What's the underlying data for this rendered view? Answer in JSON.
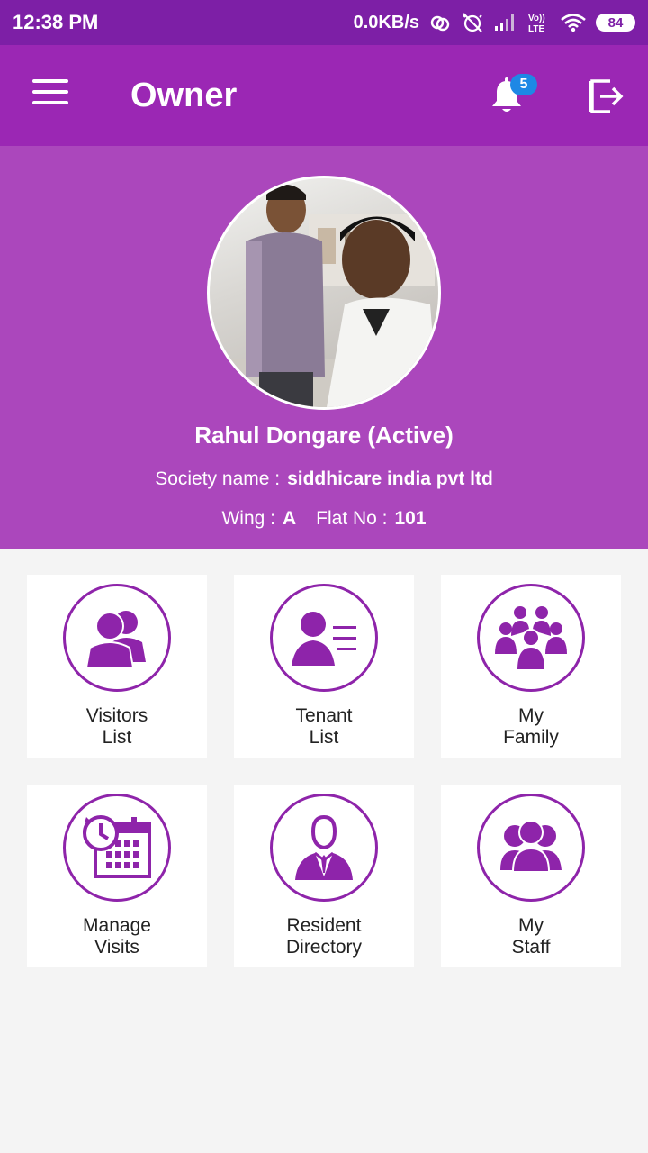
{
  "status_bar": {
    "time": "12:38 PM",
    "network_speed": "0.0KB/s",
    "battery": "84",
    "icons": [
      "hotspot-icon",
      "alarm-off-icon",
      "signal-icon",
      "volte-icon",
      "wifi-icon",
      "battery-icon"
    ]
  },
  "app_bar": {
    "title": "Owner",
    "notification_count": "5",
    "icons": [
      "menu-icon",
      "bell-icon",
      "logout-icon"
    ]
  },
  "profile": {
    "name": "Rahul Dongare (Active)",
    "society_label": "Society name :",
    "society_value": "siddhicare india pvt ltd",
    "wing_label": "Wing :",
    "wing_value": "A",
    "flat_label": "Flat No :",
    "flat_value": "101"
  },
  "tiles": [
    {
      "line1": "Visitors",
      "line2": "List",
      "icon": "visitors-icon"
    },
    {
      "line1": "Tenant",
      "line2": "List",
      "icon": "tenant-list-icon"
    },
    {
      "line1": "My",
      "line2": "Family",
      "icon": "family-icon"
    },
    {
      "line1": "Manage",
      "line2": "Visits",
      "icon": "calendar-clock-icon"
    },
    {
      "line1": "Resident",
      "line2": "Directory",
      "icon": "resident-icon"
    },
    {
      "line1": "My",
      "line2": "Staff",
      "icon": "staff-icon"
    }
  ],
  "colors": {
    "status_bar": "#7d1fa6",
    "app_bar": "#9b27b4",
    "profile_bg": "#ab47bc",
    "icon_purple": "#8e24aa",
    "badge": "#1e88e5",
    "page_bg": "#f4f4f4"
  }
}
